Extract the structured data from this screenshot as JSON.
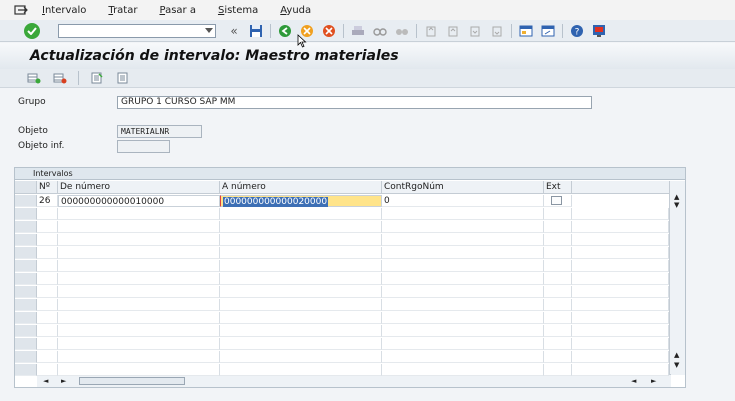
{
  "menu": {
    "items": [
      {
        "label": "Intervalo",
        "u": "I",
        "rest": "ntervalo"
      },
      {
        "label": "Tratar",
        "u": "T",
        "rest": "ratar"
      },
      {
        "label": "Pasar a",
        "u": "P",
        "rest": "asar a"
      },
      {
        "label": "Sistema",
        "u": "S",
        "rest": "istema"
      },
      {
        "label": "Ayuda",
        "u": "A",
        "rest": "yuda"
      }
    ]
  },
  "toolbar": {
    "command_value": "",
    "back_glyph": "«"
  },
  "title": "Actualización de intervalo: Maestro materiales",
  "form": {
    "grupo_label": "Grupo",
    "grupo_value": "GRUPO 1 CURSO SAP MM",
    "objeto_label": "Objeto",
    "objeto_value": "MATERIALNR",
    "objeto_inf_label": "Objeto inf.",
    "objeto_inf_value": ""
  },
  "table": {
    "caption": "Intervalos",
    "columns": [
      "Nº",
      "De número",
      "A número",
      "ContRgoNúm",
      "Ext"
    ],
    "rows": [
      {
        "no": "26",
        "from": "000000000000010000",
        "to": "000000000000020000",
        "cont": "0",
        "ext": false
      }
    ]
  },
  "colors": {
    "accent_green": "#3aa83a",
    "highlight_yellow": "#ffe48a",
    "selection_blue": "#3d6fb5"
  }
}
